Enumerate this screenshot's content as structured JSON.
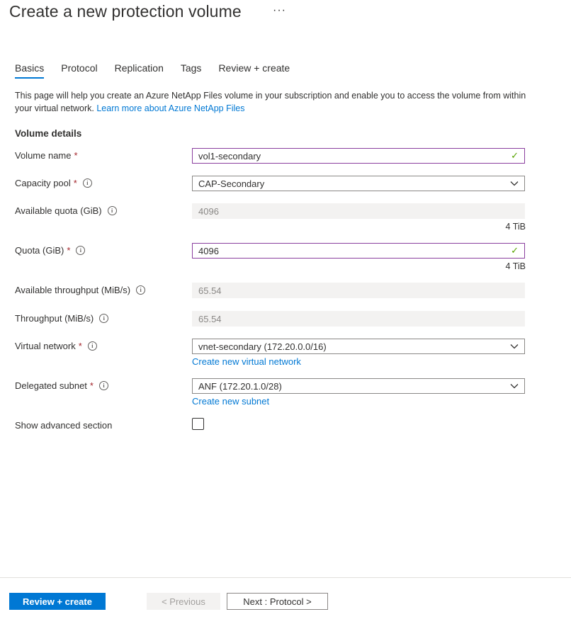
{
  "header": {
    "title": "Create a new protection volume",
    "more": "···"
  },
  "tabs": [
    {
      "label": "Basics",
      "active": true
    },
    {
      "label": "Protocol"
    },
    {
      "label": "Replication"
    },
    {
      "label": "Tags"
    },
    {
      "label": "Review + create"
    }
  ],
  "intro": {
    "text": "This page will help you create an Azure NetApp Files volume in your subscription and enable you to access the volume from within your virtual network.",
    "link": "Learn more about Azure NetApp Files"
  },
  "section_title": "Volume details",
  "fields": {
    "volume_name": {
      "label": "Volume name",
      "value": "vol1-secondary"
    },
    "capacity_pool": {
      "label": "Capacity pool",
      "value": "CAP-Secondary"
    },
    "available_quota": {
      "label": "Available quota (GiB)",
      "value": "4096",
      "unit": "4 TiB"
    },
    "quota": {
      "label": "Quota (GiB)",
      "value": "4096",
      "unit": "4 TiB"
    },
    "available_throughput": {
      "label": "Available throughput (MiB/s)",
      "value": "65.54"
    },
    "throughput": {
      "label": "Throughput (MiB/s)",
      "value": "65.54"
    },
    "virtual_network": {
      "label": "Virtual network",
      "value": "vnet-secondary (172.20.0.0/16)",
      "link": "Create new virtual network"
    },
    "delegated_subnet": {
      "label": "Delegated subnet",
      "value": "ANF (172.20.1.0/28)",
      "link": "Create new subnet"
    },
    "advanced": {
      "label": "Show advanced section",
      "checked": false
    }
  },
  "symbols": {
    "required": "*",
    "info": "i",
    "check": "✓"
  },
  "footer": {
    "review_create": "Review + create",
    "previous": "< Previous",
    "next": "Next : Protocol >"
  }
}
